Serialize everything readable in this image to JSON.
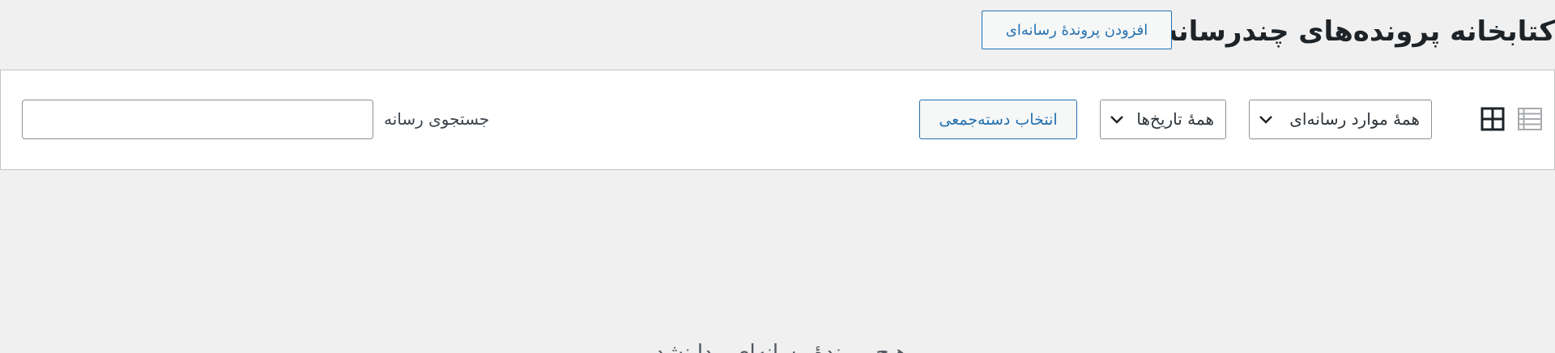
{
  "header": {
    "title": "کتابخانه پرونده‌های چندرسانه‌ای",
    "add_new_label": "افزودن پروندهٔ رسانه‌ای"
  },
  "toolbar": {
    "view_modes": {
      "list_icon": "list-view-icon",
      "grid_icon": "grid-view-icon",
      "active": "grid"
    },
    "media_type_filter": {
      "selected": "همهٔ موارد رسانه‌ای"
    },
    "date_filter": {
      "selected": "همهٔ تاریخ‌ها"
    },
    "bulk_select_label": "انتخاب دسته‌جمعی",
    "search": {
      "label": "جستجوی رسانه",
      "value": ""
    }
  },
  "main": {
    "empty_message": "هیچ پروندهٔ رسانه‌ای پیدا نشد."
  },
  "colors": {
    "accent": "#2271b1",
    "background": "#f0f0f1",
    "panel": "#ffffff",
    "border": "#c3c4c7",
    "text": "#1d2327"
  }
}
